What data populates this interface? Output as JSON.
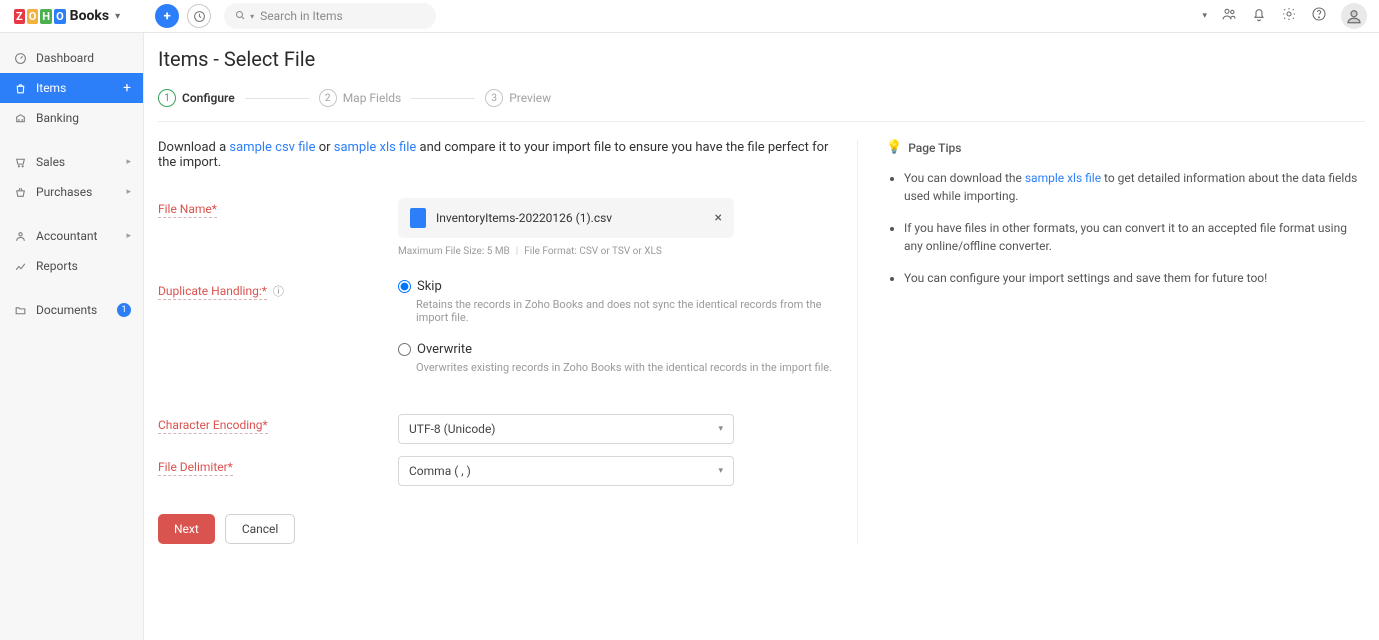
{
  "logo_text": "Books",
  "search_placeholder": "Search in Items",
  "org_name": "",
  "sidebar": {
    "items": [
      {
        "label": "Dashboard"
      },
      {
        "label": "Items"
      },
      {
        "label": "Banking"
      },
      {
        "label": "Sales"
      },
      {
        "label": "Purchases"
      },
      {
        "label": "Accountant"
      },
      {
        "label": "Reports"
      },
      {
        "label": "Documents",
        "badge": "1"
      }
    ]
  },
  "page_title": "Items - Select File",
  "steps": {
    "s1": "Configure",
    "s2": "Map Fields",
    "s3": "Preview"
  },
  "intro": {
    "pre": "Download a ",
    "csv": "sample csv file",
    "or": " or ",
    "xls": "sample xls file",
    "post": " and compare it to your import file to ensure you have the file perfect for the import."
  },
  "labels": {
    "file_name": "File Name*",
    "dup": "Duplicate Handling:*",
    "enc": "Character Encoding*",
    "delim": "File Delimiter*"
  },
  "file": {
    "name": "InventoryItems-20220126 (1).csv",
    "size_note": "Maximum File Size: 5 MB",
    "format_note": "File Format: CSV or TSV or XLS"
  },
  "dup": {
    "skip": "Skip",
    "skip_desc": "Retains the records in Zoho Books and does not sync the identical records from the import file.",
    "over": "Overwrite",
    "over_desc": "Overwrites existing records in Zoho Books with the identical records in the import file."
  },
  "enc_value": "UTF-8 (Unicode)",
  "delim_value": "Comma ( , )",
  "buttons": {
    "next": "Next",
    "cancel": "Cancel"
  },
  "tips": {
    "heading": "Page Tips",
    "t1a": "You can download the ",
    "t1link": "sample xls file",
    "t1b": " to get detailed information about the data fields used while importing.",
    "t2": "If you have files in other formats, you can convert it to an accepted file format using any online/offline converter.",
    "t3": "You can configure your import settings and save them for future too!"
  }
}
